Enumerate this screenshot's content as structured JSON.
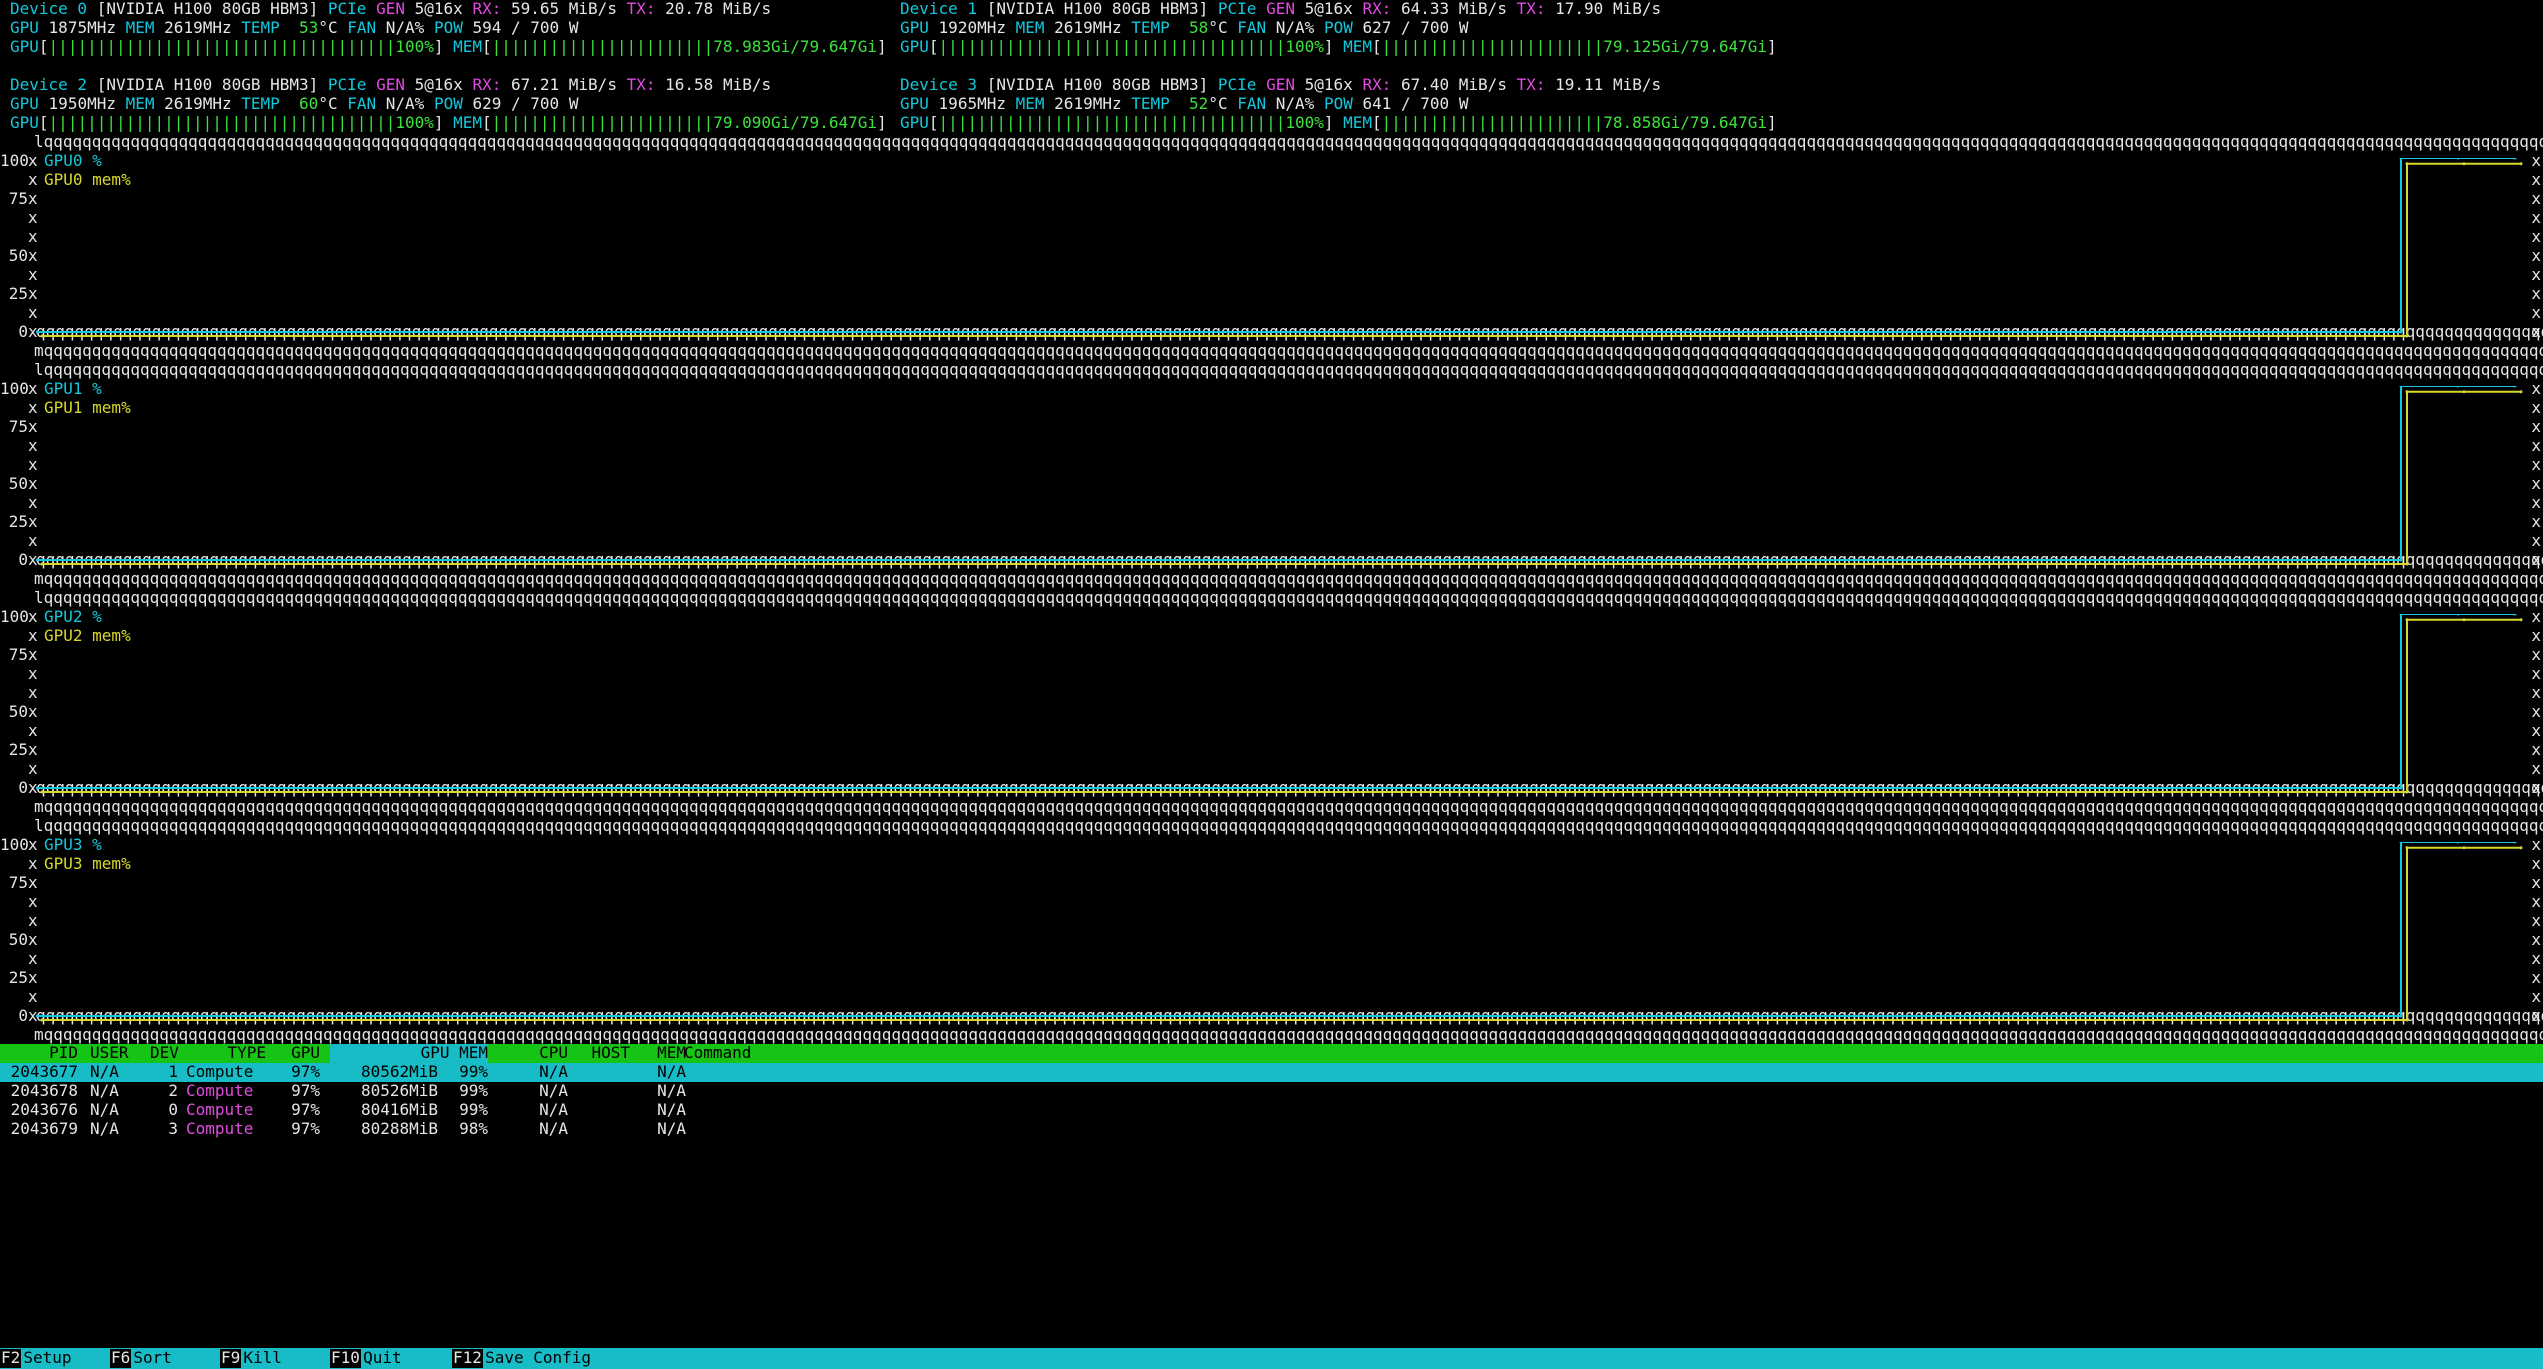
{
  "devices": [
    {
      "label": "Device 0",
      "model": "[NVIDIA H100 80GB HBM3]",
      "pcie_label": "PCIe",
      "gen_label": "GEN",
      "gen": "5@16x",
      "rx_label": "RX:",
      "rx": "59.65 MiB/s",
      "tx_label": "TX:",
      "tx": "20.78 MiB/s",
      "gpu_clock_label": "GPU",
      "gpu_clock": "1875MHz",
      "mem_clock_label": "MEM",
      "mem_clock": "2619MHz",
      "temp_label": "TEMP",
      "temp": "53",
      "temp_unit": "°C",
      "fan_label": "FAN",
      "fan": "N/A%",
      "pow_label": "POW",
      "pow": "594 / 700 W",
      "util_bar_label": "GPU",
      "util_bar": "||||||||||||||||||||||||||||||||||||100%",
      "mem_bar_label": "MEM",
      "mem_bar": "|||||||||||||||||||||||78.983Gi/79.647Gi"
    },
    {
      "label": "Device 1",
      "model": "[NVIDIA H100 80GB HBM3]",
      "pcie_label": "PCIe",
      "gen_label": "GEN",
      "gen": "5@16x",
      "rx_label": "RX:",
      "rx": "64.33 MiB/s",
      "tx_label": "TX:",
      "tx": "17.90 MiB/s",
      "gpu_clock_label": "GPU",
      "gpu_clock": "1920MHz",
      "mem_clock_label": "MEM",
      "mem_clock": "2619MHz",
      "temp_label": "TEMP",
      "temp": "58",
      "temp_unit": "°C",
      "fan_label": "FAN",
      "fan": "N/A%",
      "pow_label": "POW",
      "pow": "627 / 700 W",
      "util_bar_label": "GPU",
      "util_bar": "||||||||||||||||||||||||||||||||||||100%",
      "mem_bar_label": "MEM",
      "mem_bar": "|||||||||||||||||||||||79.125Gi/79.647Gi"
    },
    {
      "label": "Device 2",
      "model": "[NVIDIA H100 80GB HBM3]",
      "pcie_label": "PCIe",
      "gen_label": "GEN",
      "gen": "5@16x",
      "rx_label": "RX:",
      "rx": "67.21 MiB/s",
      "tx_label": "TX:",
      "tx": "16.58 MiB/s",
      "gpu_clock_label": "GPU",
      "gpu_clock": "1950MHz",
      "mem_clock_label": "MEM",
      "mem_clock": "2619MHz",
      "temp_label": "TEMP",
      "temp": "60",
      "temp_unit": "°C",
      "fan_label": "FAN",
      "fan": "N/A%",
      "pow_label": "POW",
      "pow": "629 / 700 W",
      "util_bar_label": "GPU",
      "util_bar": "||||||||||||||||||||||||||||||||||||100%",
      "mem_bar_label": "MEM",
      "mem_bar": "|||||||||||||||||||||||79.090Gi/79.647Gi"
    },
    {
      "label": "Device 3",
      "model": "[NVIDIA H100 80GB HBM3]",
      "pcie_label": "PCIe",
      "gen_label": "GEN",
      "gen": "5@16x",
      "rx_label": "RX:",
      "rx": "67.40 MiB/s",
      "tx_label": "TX:",
      "tx": "19.11 MiB/s",
      "gpu_clock_label": "GPU",
      "gpu_clock": "1965MHz",
      "mem_clock_label": "MEM",
      "mem_clock": "2619MHz",
      "temp_label": "TEMP",
      "temp": "52",
      "temp_unit": "°C",
      "fan_label": "FAN",
      "fan": "N/A%",
      "pow_label": "POW",
      "pow": "641 / 700 W",
      "util_bar_label": "GPU",
      "util_bar": "||||||||||||||||||||||||||||||||||||100%",
      "mem_bar_label": "MEM",
      "mem_bar": "|||||||||||||||||||||||78.858Gi/79.647Gi"
    }
  ],
  "chart_data": [
    {
      "type": "line",
      "title": "",
      "y_ticks": [
        "100",
        "75",
        "50",
        "25",
        "0"
      ],
      "ylim": [
        0,
        100
      ],
      "series": [
        {
          "name": "GPU0 %",
          "values": [
            0,
            0,
            100,
            100,
            100
          ]
        },
        {
          "name": "GPU0 mem%",
          "values": [
            0,
            0,
            99,
            99,
            99
          ]
        }
      ]
    },
    {
      "type": "line",
      "title": "",
      "y_ticks": [
        "100",
        "75",
        "50",
        "25",
        "0"
      ],
      "ylim": [
        0,
        100
      ],
      "series": [
        {
          "name": "GPU1 %",
          "values": [
            0,
            0,
            100,
            100,
            100
          ]
        },
        {
          "name": "GPU1 mem%",
          "values": [
            0,
            0,
            99,
            99,
            99
          ]
        }
      ]
    },
    {
      "type": "line",
      "title": "",
      "y_ticks": [
        "100",
        "75",
        "50",
        "25",
        "0"
      ],
      "ylim": [
        0,
        100
      ],
      "series": [
        {
          "name": "GPU2 %",
          "values": [
            0,
            0,
            100,
            100,
            100
          ]
        },
        {
          "name": "GPU2 mem%",
          "values": [
            0,
            0,
            99,
            99,
            99
          ]
        }
      ]
    },
    {
      "type": "line",
      "title": "",
      "y_ticks": [
        "100",
        "75",
        "50",
        "25",
        "0"
      ],
      "ylim": [
        0,
        100
      ],
      "series": [
        {
          "name": "GPU3 %",
          "values": [
            0,
            0,
            100,
            100,
            100
          ]
        },
        {
          "name": "GPU3 mem%",
          "values": [
            0,
            0,
            99,
            99,
            99
          ]
        }
      ]
    }
  ],
  "chart_colors": {
    "util": "#11c8dc",
    "mem": "#d8d82c",
    "border": "#e6e6e6"
  },
  "process_table": {
    "headers": {
      "pid": "PID",
      "user": "USER",
      "dev": "DEV",
      "type": "TYPE",
      "gpu": "GPU",
      "gpu_mem": "GPU MEM",
      "cpu": "CPU",
      "host": "HOST",
      "mem": "MEM",
      "command": "Command"
    },
    "rows": [
      {
        "pid": "2043677",
        "user": "N/A",
        "dev": "1",
        "type": "Compute",
        "gpu": "97%",
        "gpu_mem": "80562MiB",
        "mem_pct": "99%",
        "cpu": "N/A",
        "host_mem": "N/A",
        "command": ""
      },
      {
        "pid": "2043678",
        "user": "N/A",
        "dev": "2",
        "type": "Compute",
        "gpu": "97%",
        "gpu_mem": "80526MiB",
        "mem_pct": "99%",
        "cpu": "N/A",
        "host_mem": "N/A",
        "command": ""
      },
      {
        "pid": "2043676",
        "user": "N/A",
        "dev": "0",
        "type": "Compute",
        "gpu": "97%",
        "gpu_mem": "80416MiB",
        "mem_pct": "99%",
        "cpu": "N/A",
        "host_mem": "N/A",
        "command": ""
      },
      {
        "pid": "2043679",
        "user": "N/A",
        "dev": "3",
        "type": "Compute",
        "gpu": "97%",
        "gpu_mem": "80288MiB",
        "mem_pct": "98%",
        "cpu": "N/A",
        "host_mem": "N/A",
        "command": ""
      }
    ]
  },
  "footer": {
    "items": [
      {
        "key": "F2",
        "label": "Setup"
      },
      {
        "key": "F6",
        "label": "Sort"
      },
      {
        "key": "F9",
        "label": "Kill"
      },
      {
        "key": "F10",
        "label": "Quit"
      },
      {
        "key": "F12",
        "label": "Save Config"
      }
    ]
  }
}
